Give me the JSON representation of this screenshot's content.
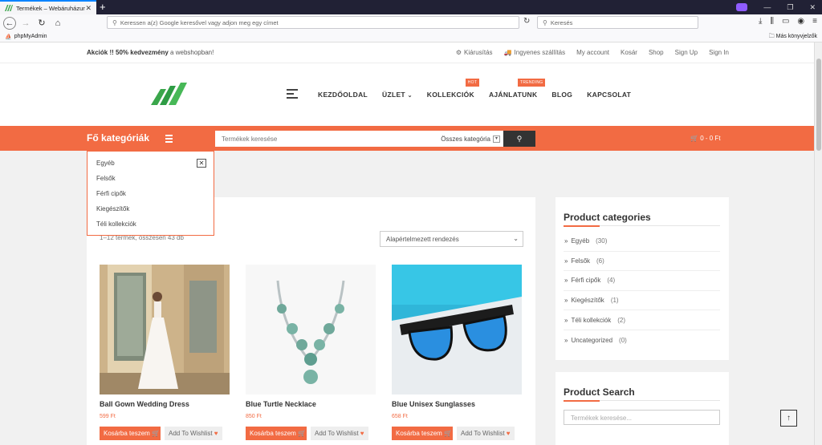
{
  "browser": {
    "tab_title": "Termékek – Webáruházunk",
    "url_placeholder": "Keressen a(z) Google keresővel vagy adjon meg egy címet",
    "search_placeholder": "Keresés",
    "bookmark": "phpMyAdmin",
    "other_bookmarks": "Más könyvjelzők"
  },
  "topbar": {
    "promo_bold": "Akciók !! 50% kedvezmény",
    "promo_rest": " a webshopban!",
    "links": [
      "Kiárusítás",
      "Ingyenes szállítás",
      "My account",
      "Kosár",
      "Shop",
      "Sign Up",
      "Sign In"
    ]
  },
  "nav": {
    "items": [
      {
        "label": "KEZDŐOLDAL",
        "badge": ""
      },
      {
        "label": "ÜZLET",
        "badge": "",
        "dropdown": true
      },
      {
        "label": "KOLLEKCIÓK",
        "badge": "HOT"
      },
      {
        "label": "AJÁNLATUNK",
        "badge": "TRENDING"
      },
      {
        "label": "BLOG",
        "badge": ""
      },
      {
        "label": "KAPCSOLAT",
        "badge": ""
      }
    ]
  },
  "catbar": {
    "title": "Fő kategóriák",
    "search_placeholder": "Termékek keresése",
    "category_select": "Összes kategória",
    "cart": "0 -  0 Ft"
  },
  "categories_dropdown": [
    "Egyéb",
    "Felsők",
    "Férfi cipők",
    "Kiegészítők",
    "Téli kollekciók"
  ],
  "shop": {
    "result_count": "1–12 termék, összesen 43 db",
    "sort": "Alapértelmezett rendezés",
    "products": [
      {
        "name": "Ball Gown Wedding Dress",
        "price": "599 Ft",
        "cart": "Kosárba teszem",
        "wish": "Add To Wishlist"
      },
      {
        "name": "Blue Turtle Necklace",
        "price": "850 Ft",
        "cart": "Kosárba teszem",
        "wish": "Add To Wishlist"
      },
      {
        "name": "Blue Unisex Sunglasses",
        "price": "658 Ft",
        "cart": "Kosárba teszem",
        "wish": "Add To Wishlist"
      }
    ]
  },
  "sidebar": {
    "categories_title": "Product categories",
    "categories": [
      {
        "label": "Egyéb",
        "count": "(30)"
      },
      {
        "label": "Felsők",
        "count": "(6)"
      },
      {
        "label": "Férfi cipők",
        "count": "(4)"
      },
      {
        "label": "Kiegészítők",
        "count": "(1)"
      },
      {
        "label": "Téli kollekciók",
        "count": "(2)"
      },
      {
        "label": "Uncategorized",
        "count": "(0)"
      }
    ],
    "search_title": "Product Search",
    "search_placeholder": "Termékek keresése..."
  },
  "colors": {
    "accent": "#f26b43",
    "dark": "#333333"
  }
}
